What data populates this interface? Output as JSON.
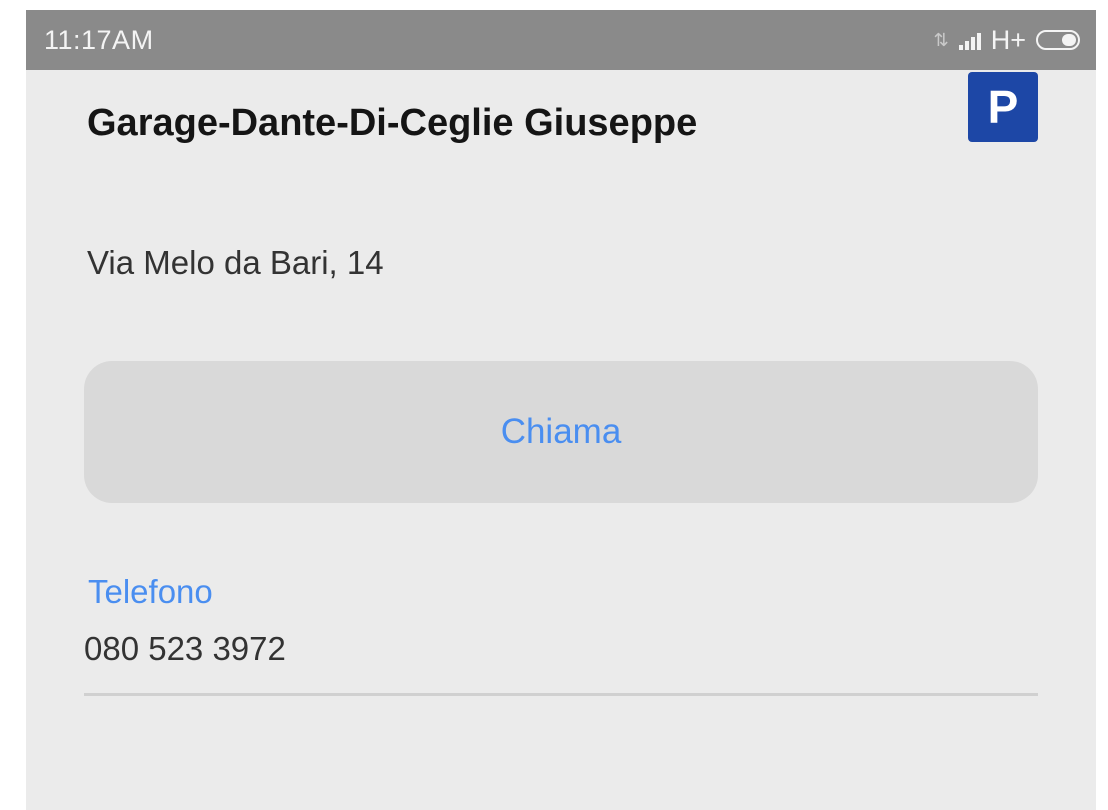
{
  "status_bar": {
    "time": "11:17AM",
    "data_arrows": "⇅",
    "network_type": "H+"
  },
  "place": {
    "title": "Garage-Dante-Di-Ceglie Giuseppe",
    "category_icon": "parking-icon",
    "category_icon_glyph": "P",
    "address": "Via Melo da Bari,  14"
  },
  "actions": {
    "call_label": "Chiama"
  },
  "phone": {
    "label": "Telefono",
    "number": "080 523 3972"
  },
  "colors": {
    "accent": "#4a8ef0",
    "parking_blue": "#1d47a6",
    "status_bar": "#8a8a8a",
    "background": "#ebebeb"
  }
}
